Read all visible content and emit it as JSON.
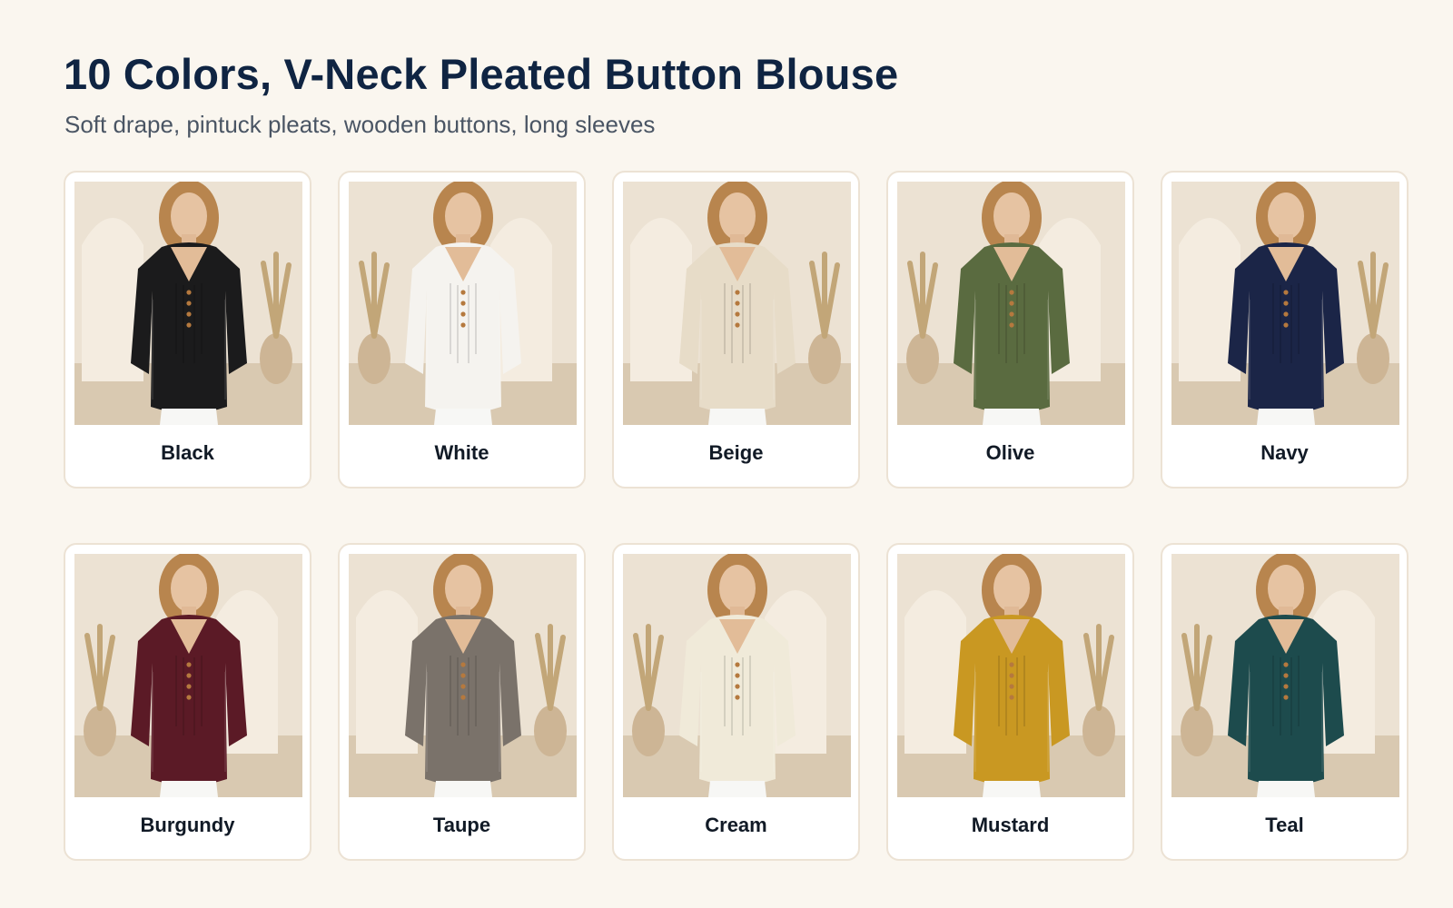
{
  "header": {
    "title": "10 Colors, V-Neck Pleated Button Blouse",
    "subtitle": "Soft drape, pintuck pleats, wooden buttons, long sleeves"
  },
  "colors": [
    {
      "name": "Black",
      "swatch": "#1b1b1c"
    },
    {
      "name": "White",
      "swatch": "#f5f3ef"
    },
    {
      "name": "Beige",
      "swatch": "#e7dcc8"
    },
    {
      "name": "Olive",
      "swatch": "#5a6b40"
    },
    {
      "name": "Navy",
      "swatch": "#1b2547"
    },
    {
      "name": "Burgundy",
      "swatch": "#5b1a26"
    },
    {
      "name": "Taupe",
      "swatch": "#7a726a"
    },
    {
      "name": "Cream",
      "swatch": "#f0ead9"
    },
    {
      "name": "Mustard",
      "swatch": "#c99822"
    },
    {
      "name": "Teal",
      "swatch": "#1d4b4d"
    }
  ]
}
